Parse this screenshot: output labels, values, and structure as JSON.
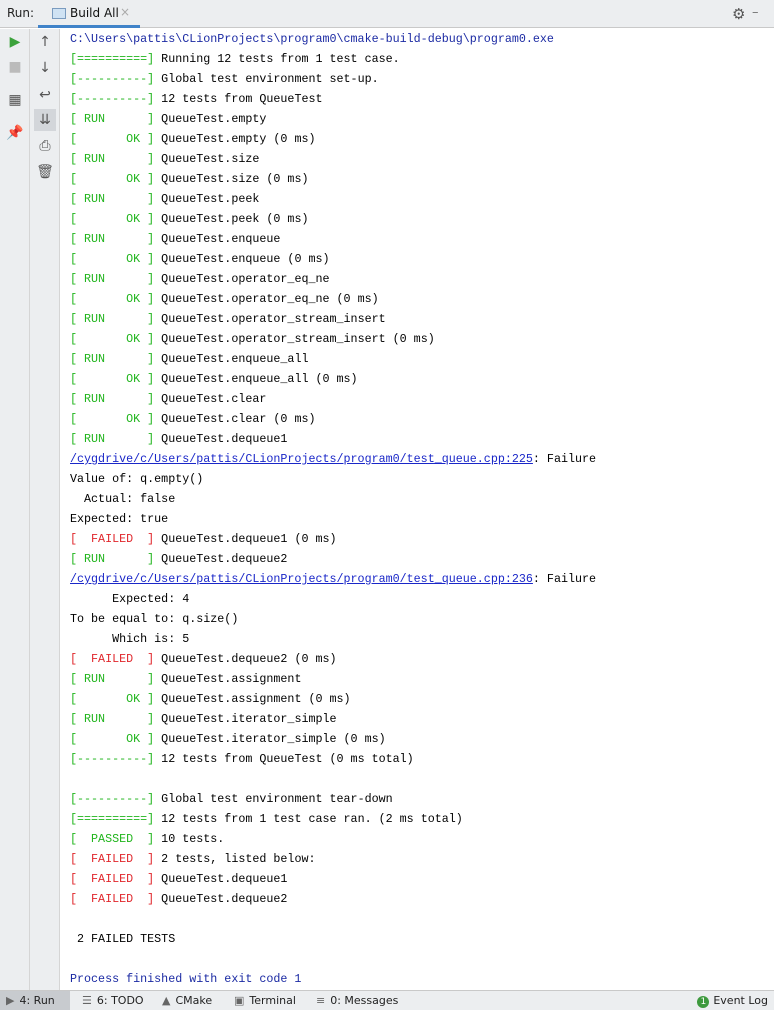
{
  "header": {
    "run_label": "Run:",
    "tab_label": "Build All",
    "close": "×",
    "settings_icon": "gear-icon",
    "hide_icon": "minimize-icon"
  },
  "colors": {
    "green": "#21b51d",
    "red": "#e0262b",
    "link": "#1a27c8",
    "process": "#1b2aa3"
  },
  "console": [
    [
      [
        "C:\\Users\\pattis\\CLionProjects\\program0\\cmake-build-debug\\program0.exe",
        "p"
      ]
    ],
    [
      [
        "[==========]",
        "g"
      ],
      [
        " Running 12 tests from 1 test case.",
        "n"
      ]
    ],
    [
      [
        "[----------]",
        "g"
      ],
      [
        " Global test environment set-up.",
        "n"
      ]
    ],
    [
      [
        "[----------]",
        "g"
      ],
      [
        " 12 tests from QueueTest",
        "n"
      ]
    ],
    [
      [
        "[ RUN      ]",
        "g"
      ],
      [
        " QueueTest.empty",
        "n"
      ]
    ],
    [
      [
        "[       OK ]",
        "g"
      ],
      [
        " QueueTest.empty (0 ms)",
        "n"
      ]
    ],
    [
      [
        "[ RUN      ]",
        "g"
      ],
      [
        " QueueTest.size",
        "n"
      ]
    ],
    [
      [
        "[       OK ]",
        "g"
      ],
      [
        " QueueTest.size (0 ms)",
        "n"
      ]
    ],
    [
      [
        "[ RUN      ]",
        "g"
      ],
      [
        " QueueTest.peek",
        "n"
      ]
    ],
    [
      [
        "[       OK ]",
        "g"
      ],
      [
        " QueueTest.peek (0 ms)",
        "n"
      ]
    ],
    [
      [
        "[ RUN      ]",
        "g"
      ],
      [
        " QueueTest.enqueue",
        "n"
      ]
    ],
    [
      [
        "[       OK ]",
        "g"
      ],
      [
        " QueueTest.enqueue (0 ms)",
        "n"
      ]
    ],
    [
      [
        "[ RUN      ]",
        "g"
      ],
      [
        " QueueTest.operator_eq_ne",
        "n"
      ]
    ],
    [
      [
        "[       OK ]",
        "g"
      ],
      [
        " QueueTest.operator_eq_ne (0 ms)",
        "n"
      ]
    ],
    [
      [
        "[ RUN      ]",
        "g"
      ],
      [
        " QueueTest.operator_stream_insert",
        "n"
      ]
    ],
    [
      [
        "[       OK ]",
        "g"
      ],
      [
        " QueueTest.operator_stream_insert (0 ms)",
        "n"
      ]
    ],
    [
      [
        "[ RUN      ]",
        "g"
      ],
      [
        " QueueTest.enqueue_all",
        "n"
      ]
    ],
    [
      [
        "[       OK ]",
        "g"
      ],
      [
        " QueueTest.enqueue_all (0 ms)",
        "n"
      ]
    ],
    [
      [
        "[ RUN      ]",
        "g"
      ],
      [
        " QueueTest.clear",
        "n"
      ]
    ],
    [
      [
        "[       OK ]",
        "g"
      ],
      [
        " QueueTest.clear (0 ms)",
        "n"
      ]
    ],
    [
      [
        "[ RUN      ]",
        "g"
      ],
      [
        " QueueTest.dequeue1",
        "n"
      ]
    ],
    [
      [
        "/cygdrive/c/Users/pattis/CLionProjects/program0/test_queue.cpp:225",
        "b"
      ],
      [
        ": Failure",
        "n"
      ]
    ],
    [
      [
        "Value of: q.empty()",
        "n"
      ]
    ],
    [
      [
        "  Actual: false",
        "n"
      ]
    ],
    [
      [
        "Expected: true",
        "n"
      ]
    ],
    [
      [
        "[  FAILED  ]",
        "r"
      ],
      [
        " QueueTest.dequeue1 (0 ms)",
        "n"
      ]
    ],
    [
      [
        "[ RUN      ]",
        "g"
      ],
      [
        " QueueTest.dequeue2",
        "n"
      ]
    ],
    [
      [
        "/cygdrive/c/Users/pattis/CLionProjects/program0/test_queue.cpp:236",
        "b"
      ],
      [
        ": Failure",
        "n"
      ]
    ],
    [
      [
        "      Expected: 4",
        "n"
      ]
    ],
    [
      [
        "To be equal to: q.size()",
        "n"
      ]
    ],
    [
      [
        "      Which is: 5",
        "n"
      ]
    ],
    [
      [
        "[  FAILED  ]",
        "r"
      ],
      [
        " QueueTest.dequeue2 (0 ms)",
        "n"
      ]
    ],
    [
      [
        "[ RUN      ]",
        "g"
      ],
      [
        " QueueTest.assignment",
        "n"
      ]
    ],
    [
      [
        "[       OK ]",
        "g"
      ],
      [
        " QueueTest.assignment (0 ms)",
        "n"
      ]
    ],
    [
      [
        "[ RUN      ]",
        "g"
      ],
      [
        " QueueTest.iterator_simple",
        "n"
      ]
    ],
    [
      [
        "[       OK ]",
        "g"
      ],
      [
        " QueueTest.iterator_simple (0 ms)",
        "n"
      ]
    ],
    [
      [
        "[----------]",
        "g"
      ],
      [
        " 12 tests from QueueTest (0 ms total)",
        "n"
      ]
    ],
    [],
    [
      [
        "[----------]",
        "g"
      ],
      [
        " Global test environment tear-down",
        "n"
      ]
    ],
    [
      [
        "[==========]",
        "g"
      ],
      [
        " 12 tests from 1 test case ran. (2 ms total)",
        "n"
      ]
    ],
    [
      [
        "[  PASSED  ]",
        "g"
      ],
      [
        " 10 tests.",
        "n"
      ]
    ],
    [
      [
        "[  FAILED  ]",
        "r"
      ],
      [
        " 2 tests, listed below:",
        "n"
      ]
    ],
    [
      [
        "[  FAILED  ]",
        "r"
      ],
      [
        " QueueTest.dequeue1",
        "n"
      ]
    ],
    [
      [
        "[  FAILED  ]",
        "r"
      ],
      [
        " QueueTest.dequeue2",
        "n"
      ]
    ],
    [],
    [
      [
        " 2 FAILED TESTS",
        "n"
      ]
    ],
    [],
    [
      [
        "Process finished with exit code 1",
        "p"
      ]
    ]
  ],
  "bottom": {
    "tabs": [
      {
        "label": "4: Run",
        "icon": "play-icon"
      },
      {
        "label": "6: TODO",
        "icon": "list-icon"
      },
      {
        "label": "CMake",
        "icon": "cmake-icon"
      },
      {
        "label": "Terminal",
        "icon": "terminal-icon"
      },
      {
        "label": "0: Messages",
        "icon": "messages-icon"
      }
    ],
    "event_log": "Event Log",
    "event_count": "1"
  }
}
